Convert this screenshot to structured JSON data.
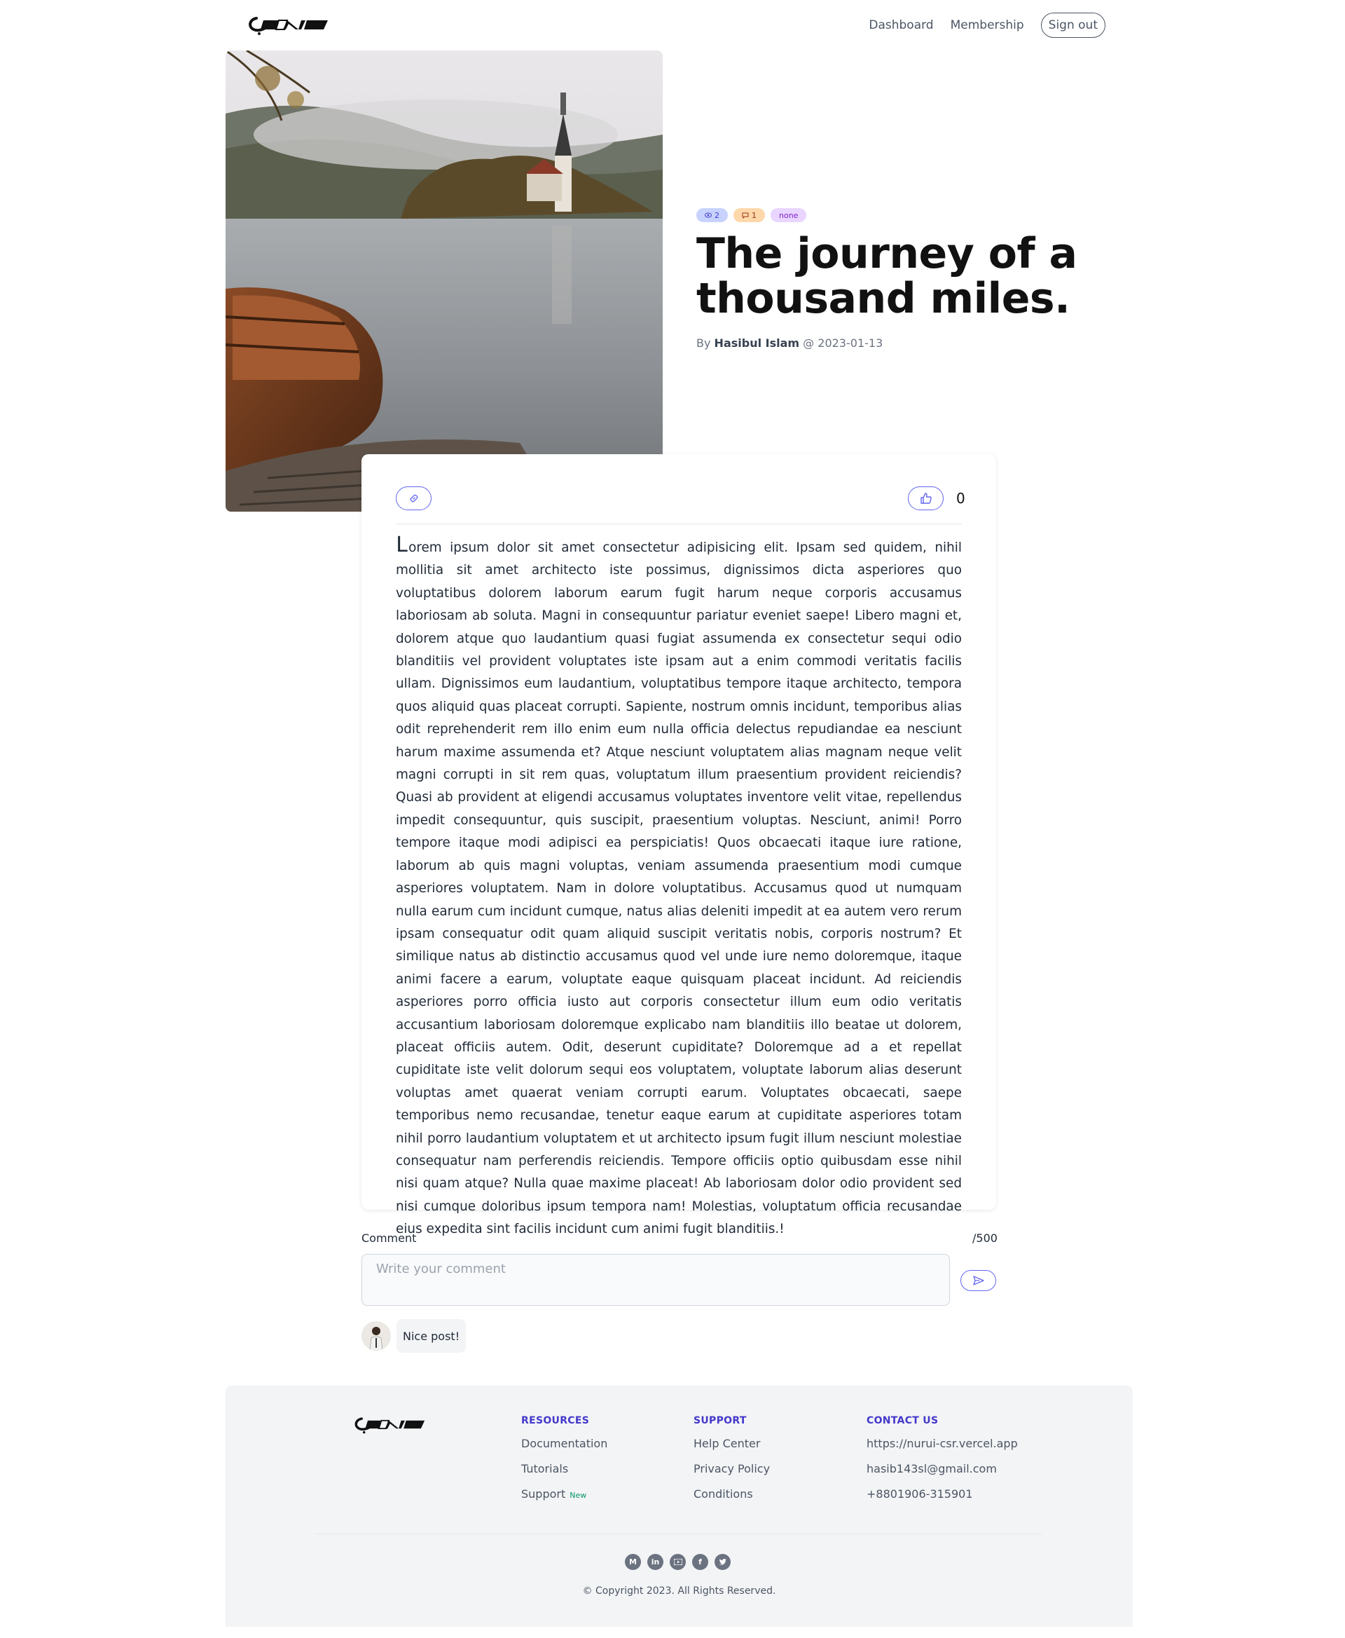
{
  "header": {
    "brand": "CANIM",
    "nav": [
      {
        "label": "Dashboard"
      },
      {
        "label": "Membership"
      }
    ],
    "signout_label": "Sign out"
  },
  "post": {
    "views": "2",
    "comments": "1",
    "category": "none",
    "title": "The journey of a thousand miles.",
    "byline_prefix": "By",
    "author": "Hasibul Islam",
    "byline_sep": "@",
    "date": "2023-01-13",
    "likes": "0",
    "body_first_letter": "L",
    "body_rest": "orem ipsum dolor sit amet consectetur adipisicing elit. Ipsam sed quidem, nihil mollitia sit amet architecto iste possimus, dignissimos dicta asperiores quo voluptatibus dolorem laborum earum fugit harum neque corporis accusamus laboriosam ab soluta. Magni in consequuntur pariatur eveniet saepe! Libero magni et, dolorem atque quo laudantium quasi fugiat assumenda ex consectetur sequi odio blanditiis vel provident voluptates iste ipsam aut a enim commodi veritatis facilis ullam. Dignissimos eum laudantium, voluptatibus tempore itaque architecto, tempora quos aliquid quas placeat corrupti. Sapiente, nostrum omnis incidunt, temporibus alias odit reprehenderit rem illo enim eum nulla officia delectus repudiandae ea nesciunt harum maxime assumenda et? Atque nesciunt voluptatem alias magnam neque velit magni corrupti in sit rem quas, voluptatum illum praesentium provident reiciendis? Quasi ab provident at eligendi accusamus voluptates inventore velit vitae, repellendus impedit consequuntur, quis suscipit, praesentium voluptas. Nesciunt, animi! Porro tempore itaque modi adipisci ea perspiciatis! Quos obcaecati itaque iure ratione, laborum ab quis magni voluptas, veniam assumenda praesentium modi cumque asperiores voluptatem. Nam in dolore voluptatibus. Accusamus quod ut numquam nulla earum cum incidunt cumque, natus alias deleniti impedit at ea autem vero rerum ipsam consequatur odit quam aliquid suscipit veritatis nobis, corporis nostrum? Et similique natus ab distinctio accusamus quod vel unde iure nemo doloremque, itaque animi facere a earum, voluptate eaque quisquam placeat incidunt. Ad reiciendis asperiores porro officia iusto aut corporis consectetur illum eum odio veritatis accusantium laboriosam doloremque explicabo nam blanditiis illo beatae ut dolorem, placeat officiis autem. Odit, deserunt cupiditate? Doloremque ad a et repellat cupiditate iste velit dolorum sequi eos voluptatem, voluptate laborum alias deserunt voluptas amet quaerat veniam corrupti earum. Voluptates obcaecati, saepe temporibus nemo recusandae, tenetur eaque earum at cupiditate asperiores totam nihil porro laudantium voluptatem et ut architecto ipsum fugit illum nesciunt molestiae consequatur nam perferendis reiciendis. Tempore officiis optio quibusdam esse nihil nisi quam atque? Nulla quae maxime placeat! Ab laboriosam dolor odio provident sed nisi cumque doloribus ipsum tempora nam! Molestias, voluptatum officia recusandae eius expedita sint facilis incidunt cum animi fugit blanditiis.!"
  },
  "comment_form": {
    "label": "Comment",
    "char_count": "/500",
    "placeholder": "Write your comment"
  },
  "comments": [
    {
      "text": "Nice post!"
    }
  ],
  "footer": {
    "resources": {
      "heading": "RESOURCES",
      "links": [
        "Documentation",
        "Tutorials",
        "Support"
      ],
      "new_tag": "New"
    },
    "support": {
      "heading": "SUPPORT",
      "links": [
        "Help Center",
        "Privacy Policy",
        "Conditions"
      ]
    },
    "contact": {
      "heading": "CONTACT US",
      "links": [
        "https://nurui-csr.vercel.app",
        "hasib143sl@gmail.com",
        "+8801906-315901"
      ]
    },
    "social": [
      "medium-icon",
      "linkedin-icon",
      "youtube-icon",
      "facebook-icon",
      "twitter-icon"
    ],
    "copyright": "© Copyright 2023. All Rights Reserved."
  },
  "colors": {
    "accent": "#6366f1",
    "footer_heading": "#4338ca",
    "footer_bg": "#f3f4f6"
  }
}
